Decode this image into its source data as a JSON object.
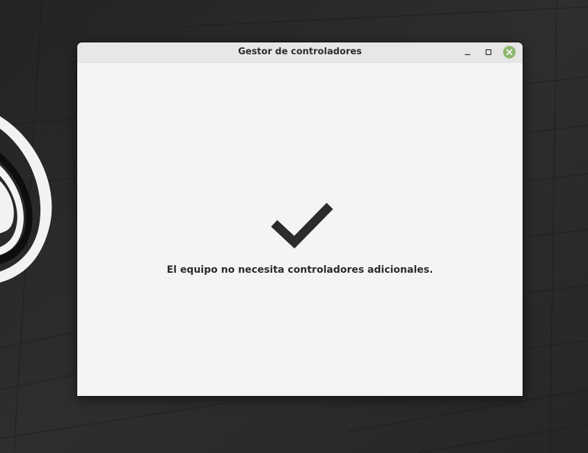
{
  "window": {
    "title": "Gestor de controladores",
    "controls": {
      "minimize_icon": "minimize-icon",
      "maximize_icon": "maximize-icon",
      "close_icon": "close-icon"
    }
  },
  "content": {
    "status_icon": "checkmark-icon",
    "message": "El equipo no necesita controladores adicionales."
  },
  "colors": {
    "close_button": "#8db86e",
    "checkmark": "#2b2b2b",
    "window_background": "#f4f4f4",
    "titlebar_background": "#e7e7e7"
  }
}
